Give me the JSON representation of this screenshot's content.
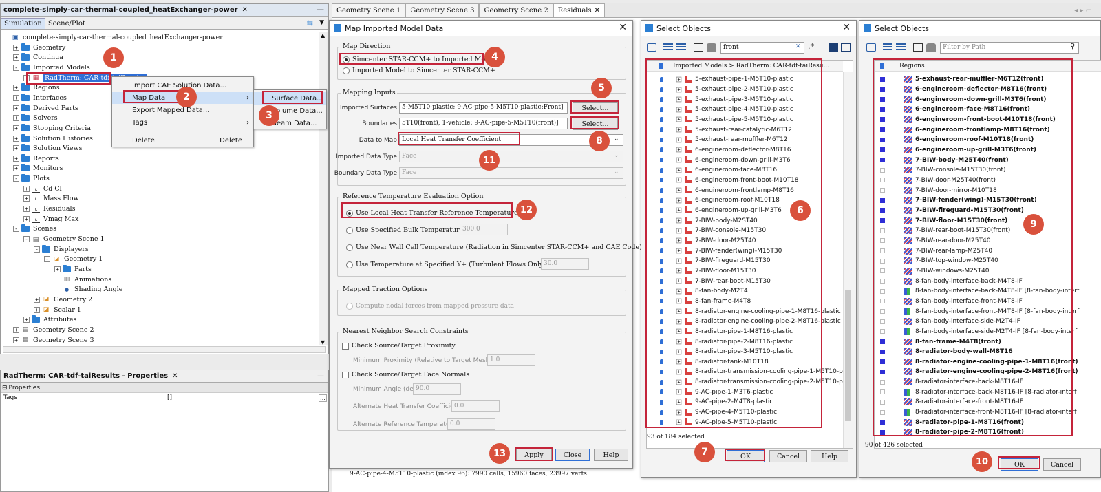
{
  "left_panel": {
    "title": "complete-simply-car-thermal-coupled_heatExchanger-power",
    "tabs": [
      "Simulation",
      "Scene/Plot"
    ],
    "tree": [
      {
        "label": "complete-simply-car-thermal-coupled_heatExchanger-power",
        "level": 0,
        "icon": "sim-icon",
        "exp": ""
      },
      {
        "label": "Geometry",
        "level": 1,
        "icon": "folder",
        "exp": "+"
      },
      {
        "label": "Continua",
        "level": 1,
        "icon": "folder",
        "exp": "+"
      },
      {
        "label": "Imported Models",
        "level": 1,
        "icon": "folder",
        "exp": "−"
      },
      {
        "label": "RadTherm: CAR-tdf-taiResults",
        "level": 2,
        "icon": "grid-icon",
        "exp": "+",
        "selected": true
      },
      {
        "label": "Regions",
        "level": 1,
        "icon": "folder",
        "exp": "+"
      },
      {
        "label": "Interfaces",
        "level": 1,
        "icon": "folder",
        "exp": "+"
      },
      {
        "label": "Derived Parts",
        "level": 1,
        "icon": "folder",
        "exp": "+"
      },
      {
        "label": "Solvers",
        "level": 1,
        "icon": "folder",
        "exp": "+"
      },
      {
        "label": "Stopping Criteria",
        "level": 1,
        "icon": "folder",
        "exp": "+"
      },
      {
        "label": "Solution Histories",
        "level": 1,
        "icon": "folder",
        "exp": "+"
      },
      {
        "label": "Solution Views",
        "level": 1,
        "icon": "folder",
        "exp": "+"
      },
      {
        "label": "Reports",
        "level": 1,
        "icon": "folder",
        "exp": "+"
      },
      {
        "label": "Monitors",
        "level": 1,
        "icon": "folder",
        "exp": "+"
      },
      {
        "label": "Plots",
        "level": 1,
        "icon": "folder",
        "exp": "−"
      },
      {
        "label": "Cd Cl",
        "level": 2,
        "icon": "plot-icon",
        "exp": "+"
      },
      {
        "label": "Mass Flow",
        "level": 2,
        "icon": "plot-icon",
        "exp": "+"
      },
      {
        "label": "Residuals",
        "level": 2,
        "icon": "plot-icon",
        "exp": "+"
      },
      {
        "label": "Vmag Max",
        "level": 2,
        "icon": "plot-icon",
        "exp": "+"
      },
      {
        "label": "Scenes",
        "level": 1,
        "icon": "folder",
        "exp": "−"
      },
      {
        "label": "Geometry Scene 1",
        "level": 2,
        "icon": "scene-icon",
        "exp": "−"
      },
      {
        "label": "Displayers",
        "level": 3,
        "icon": "folder",
        "exp": "−"
      },
      {
        "label": "Geometry 1",
        "level": 4,
        "icon": "displayer-icon",
        "exp": "−"
      },
      {
        "label": "Parts",
        "level": 5,
        "icon": "folder",
        "exp": "+"
      },
      {
        "label": "Animations",
        "level": 5,
        "icon": "film-icon",
        "exp": ""
      },
      {
        "label": "Shading Angle",
        "level": 5,
        "icon": "dot-icon",
        "exp": ""
      },
      {
        "label": "Geometry 2",
        "level": 3,
        "icon": "displayer-icon",
        "exp": "+"
      },
      {
        "label": "Scalar 1",
        "level": 3,
        "icon": "displayer-icon",
        "exp": "+"
      },
      {
        "label": "Attributes",
        "level": 2,
        "icon": "folder",
        "exp": "+"
      },
      {
        "label": "Geometry Scene 2",
        "level": 1,
        "icon": "scene-icon",
        "exp": "+"
      },
      {
        "label": "Geometry Scene 3",
        "level": 1,
        "icon": "scene-icon",
        "exp": "+"
      }
    ]
  },
  "context_menu": {
    "items": [
      "Import CAE Solution Data...",
      "Map Data",
      "Export Mapped Data...",
      "Tags",
      "Delete"
    ],
    "delete_shortcut": "Delete"
  },
  "submenu": {
    "items": [
      "Surface Data...",
      "Volume Data...",
      "Beam Data..."
    ]
  },
  "properties_panel": {
    "title": "RadTherm: CAR-tdf-taiResults - Properties",
    "section": "Properties",
    "row_label": "Tags",
    "row_value": "[]"
  },
  "top_tabs": [
    "Geometry Scene 1",
    "Geometry Scene 3",
    "Geometry Scene 2",
    "Residuals"
  ],
  "map_dialog": {
    "title": "Map Imported Model Data",
    "map_direction": {
      "label": "Map Direction",
      "options": [
        "Simcenter STAR-CCM+ to Imported Model",
        "Imported Model to Simcenter STAR-CCM+"
      ]
    },
    "mapping_inputs": {
      "label": "Mapping Inputs",
      "imported_surfaces_label": "Imported Surfaces",
      "imported_surfaces_value": "5-M5T10-plastic; 9-AC-pipe-5-M5T10-plastic:Front]",
      "boundaries_label": "Boundaries",
      "boundaries_value": "5T10(front), 1-vehicle: 9-AC-pipe-5-M5T10(front)]",
      "select_label": "Select...",
      "data_to_map_label": "Data to Map",
      "data_to_map_value": "Local Heat Transfer Coefficient",
      "imported_type_label": "Imported Data Type",
      "imported_type_value": "Face",
      "boundary_type_label": "Boundary Data Type",
      "boundary_type_value": "Face"
    },
    "ref_temp": {
      "label": "Reference Temperature Evaluation Option",
      "options": [
        "Use Local Heat Transfer Reference Temperature",
        "Use Specified Bulk Temperature",
        "Use Near Wall Cell Temperature (Radiation in Simcenter STAR-CCM+ and CAE Code)",
        "Use Temperature at Specified Y+ (Turbulent Flows Only)"
      ],
      "bulk_value": "300.0",
      "yplus_value": "30.0"
    },
    "traction": {
      "label": "Mapped Traction Options",
      "option": "Compute nodal forces from mapped pressure data"
    },
    "nn": {
      "label": "Nearest Neighbor Search Constraints",
      "check1": "Check Source/Target Proximity",
      "min_prox_label": "Minimum Proximity (Relative to Target Mesh Size)",
      "min_prox_value": "1.0",
      "check2": "Check Source/Target Face Normals",
      "min_angle_label": "Minimum Angle (deg)",
      "min_angle_value": "90.0",
      "alt_htc_label": "Alternate Heat Transfer Coefficient",
      "alt_htc_value": "0.0",
      "alt_ref_label": "Alternate Reference Temperature",
      "alt_ref_value": "0.0"
    },
    "buttons": {
      "apply": "Apply",
      "close": "Close",
      "help": "Help"
    }
  },
  "select1": {
    "title": "Select Objects",
    "filter": "front",
    "header": "Imported Models > RadTherm: CAR-tdf-taiResu...",
    "items": [
      "5-exhaust-pipe-1-M5T10-plastic",
      "5-exhaust-pipe-2-M5T10-plastic",
      "5-exhaust-pipe-3-M5T10-plastic",
      "5-exhaust-pipe-4-M5T10-plastic",
      "5-exhaust-pipe-5-M5T10-plastic",
      "5-exhaust-rear-catalytic-M6T12",
      "5-exhaust-rear-muffler-M6T12",
      "6-engineroom-deflector-M8T16",
      "6-engineroom-down-grill-M3T6",
      "6-engineroom-face-M8T16",
      "6-engineroom-front-boot-M10T18",
      "6-engineroom-frontlamp-M8T16",
      "6-engineroom-roof-M10T18",
      "6-engineroom-up-grill-M3T6",
      "7-BIW-body-M2ST40",
      "7-BIW-console-M15T30",
      "7-BIW-door-M25T40",
      "7-BIW-fender(wing)-M15T30",
      "7-BIW-fireguard-M15T30",
      "7-BIW-floor-M15T30",
      "7-BIW-rear-boot-M15T30",
      "8-fan-body-M2T4",
      "8-fan-frame-M4T8",
      "8-radiator-engine-cooling-pipe-1-M8T16-plastic",
      "8-radiator-engine-cooling-pipe-2-M8T16-plastic",
      "8-radiator-pipe-1-M8T16-plastic",
      "8-radiator-pipe-2-M8T16-plastic",
      "8-radiator-pipe-3-M5T10-plastic",
      "8-radiator-tank-M10T18",
      "8-radiator-transmission-cooling-pipe-1-M5T10-plastic",
      "8-radiator-transmission-cooling-pipe-2-M5T10-plastic",
      "9-AC-pipe-1-M3T6-plastic",
      "9-AC-pipe-2-M4T8-plastic",
      "9-AC-pipe-4-M5T10-plastic",
      "9-AC-pipe-5-M5T10-plastic"
    ],
    "status": "93 of 184 selected",
    "buttons": {
      "ok": "OK",
      "cancel": "Cancel",
      "help": "Help"
    }
  },
  "select2": {
    "title": "Select Objects",
    "filter_placeholder": "Filter by Path",
    "header": "Regions",
    "items": [
      {
        "t": "5-exhaust-rear-muffler-M6T12(front)",
        "b": true,
        "s": true
      },
      {
        "t": "6-engineroom-deflector-M8T16(front)",
        "b": true,
        "s": true
      },
      {
        "t": "6-engineroom-down-grill-M3T6(front)",
        "b": true,
        "s": true
      },
      {
        "t": "6-engineroom-face-M8T16(front)",
        "b": true,
        "s": true
      },
      {
        "t": "6-engineroom-front-boot-M10T18(front)",
        "b": true,
        "s": true
      },
      {
        "t": "6-engineroom-frontlamp-M8T16(front)",
        "b": true,
        "s": true
      },
      {
        "t": "6-engineroom-roof-M10T18(front)",
        "b": true,
        "s": true
      },
      {
        "t": "6-engineroom-up-grill-M3T6(front)",
        "b": true,
        "s": true
      },
      {
        "t": "7-BIW-body-M25T40(front)",
        "b": true,
        "s": true
      },
      {
        "t": "7-BIW-console-M15T30(front)",
        "b": false,
        "s": false
      },
      {
        "t": "7-BIW-door-M25T40(front)",
        "b": false,
        "s": false
      },
      {
        "t": "7-BIW-door-mirror-M10T18",
        "b": false,
        "s": false
      },
      {
        "t": "7-BIW-fender(wing)-M15T30(front)",
        "b": true,
        "s": true
      },
      {
        "t": "7-BIW-fireguard-M15T30(front)",
        "b": true,
        "s": true
      },
      {
        "t": "7-BIW-floor-M15T30(front)",
        "b": true,
        "s": true
      },
      {
        "t": "7-BIW-rear-boot-M15T30(front)",
        "b": false,
        "s": false
      },
      {
        "t": "7-BIW-rear-door-M25T40",
        "b": false,
        "s": false
      },
      {
        "t": "7-BIW-rear-lamp-M25T40",
        "b": false,
        "s": false
      },
      {
        "t": "7-BIW-top-window-M25T40",
        "b": false,
        "s": false
      },
      {
        "t": "7-BIW-windows-M25T40",
        "b": false,
        "s": false
      },
      {
        "t": "8-fan-body-interface-back-M4T8-IF",
        "b": false,
        "s": false
      },
      {
        "t": "8-fan-body-interface-back-M4T8-IF [8-fan-body-interf",
        "b": false,
        "s": false,
        "g": true
      },
      {
        "t": "8-fan-body-interface-front-M4T8-IF",
        "b": false,
        "s": false
      },
      {
        "t": "8-fan-body-interface-front-M4T8-IF [8-fan-body-interf",
        "b": false,
        "s": false,
        "g": true
      },
      {
        "t": "8-fan-body-interface-side-M2T4-IF",
        "b": false,
        "s": false
      },
      {
        "t": "8-fan-body-interface-side-M2T4-IF [8-fan-body-interf",
        "b": false,
        "s": false,
        "g": true
      },
      {
        "t": "8-fan-frame-M4T8(front)",
        "b": true,
        "s": true
      },
      {
        "t": "8-radiator-body-wall-M8T16",
        "b": true,
        "s": true
      },
      {
        "t": "8-radiator-engine-cooling-pipe-1-M8T16(front)",
        "b": true,
        "s": true
      },
      {
        "t": "8-radiator-engine-cooling-pipe-2-M8T16(front)",
        "b": true,
        "s": true
      },
      {
        "t": "8-radiator-interface-back-M8T16-IF",
        "b": false,
        "s": false
      },
      {
        "t": "8-radiator-interface-back-M8T16-IF [8-radiator-interf",
        "b": false,
        "s": false,
        "g": true
      },
      {
        "t": "8-radiator-interface-front-M8T16-IF",
        "b": false,
        "s": false
      },
      {
        "t": "8-radiator-interface-front-M8T16-IF [8-radiator-interf",
        "b": false,
        "s": false,
        "g": true
      },
      {
        "t": "8-radiator-pipe-1-M8T16(front)",
        "b": true,
        "s": true
      },
      {
        "t": "8-radiator-pipe-2-M8T16(front)",
        "b": true,
        "s": true
      }
    ],
    "status": "90 of 426 selected",
    "buttons": {
      "ok": "OK",
      "cancel": "Cancel"
    }
  },
  "bottom_text": "9-AC-pipe-4-M5T10-plastic (index 96): 7990 cells, 15960 faces, 23997 verts.",
  "markers": [
    "1",
    "2",
    "3",
    "4",
    "5",
    "6",
    "7",
    "8",
    "9",
    "10",
    "11",
    "12",
    "13"
  ],
  "colors": {
    "marker": "#d9513c",
    "highlight_box": "#c4243a",
    "selection": "#2f6fd6",
    "accent_blue": "#3b5bd6"
  }
}
